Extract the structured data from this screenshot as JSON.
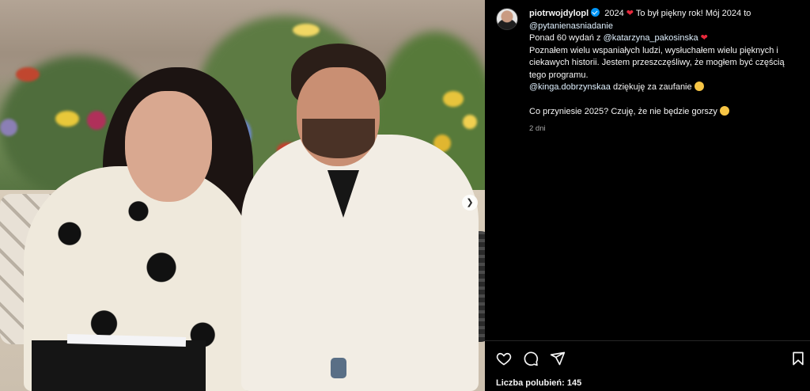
{
  "post": {
    "username": "piotrwojdylopl",
    "caption_line1_text": "2024",
    "caption_line1_rest": "To był piękny rok! Mój 2024 to",
    "mention_pytania": "@pytanienasniadanie",
    "caption_line3_pre": "Ponad 60 wydań z ",
    "mention_katarzyna": "@katarzyna_pakosinska",
    "caption_line4": "Poznałem wielu wspaniałych ludzi, wysłuchałem wielu pięknych i ciekawych historii. Jestem przeszczęśliwy, że mogłem być częścią tego programu.",
    "mention_kinga": "@kinga.dobrzynskaa",
    "caption_line5_rest": " dziękuję za zaufanie",
    "caption_line6": "Co przyniesie 2025? Czuję, że nie będzie gorszy",
    "timestamp": "2 dni",
    "likes_label": "Liczba polubień: 145"
  },
  "icons": {
    "like": "heart-icon",
    "comment": "comment-icon",
    "share": "send-icon",
    "save": "bookmark-icon",
    "next": "chevron-right-icon",
    "verified": "verified-badge-icon"
  },
  "colors": {
    "background": "#000000",
    "text": "#f5f5f5",
    "secondary_text": "#a8a8a8",
    "verified": "#0095f6",
    "heart_emoji": "#e8293c"
  }
}
